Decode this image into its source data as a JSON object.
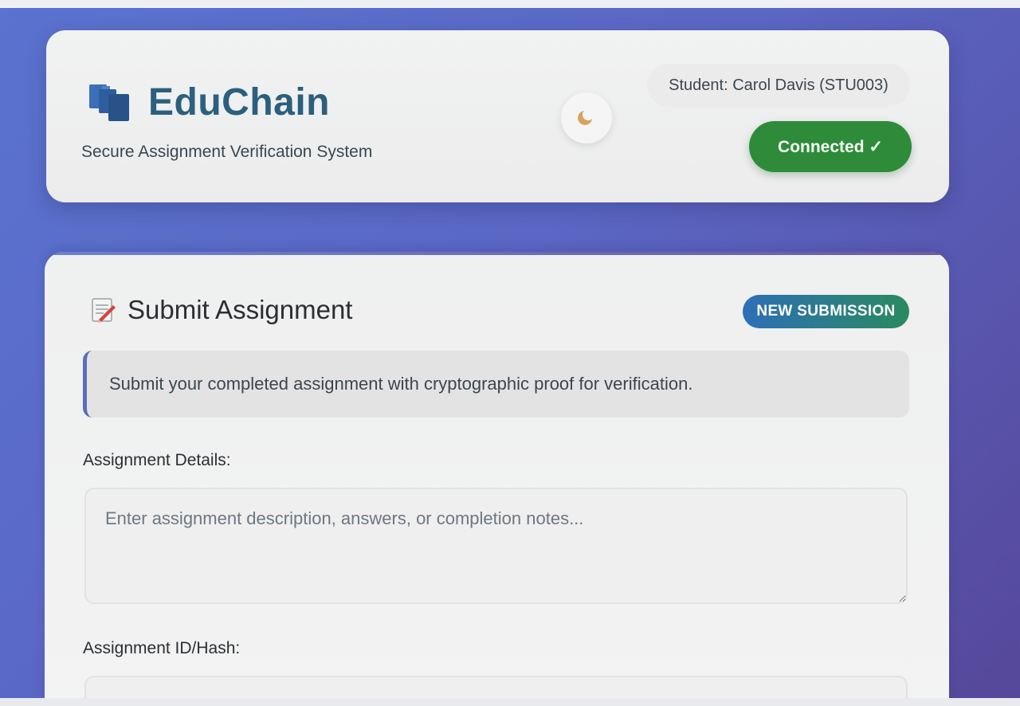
{
  "header": {
    "brand": {
      "title": "EduChain",
      "subtitle": "Secure Assignment Verification System",
      "icon": "document-stack-icon"
    },
    "theme_toggle_icon": "moon-icon",
    "student_label": "Student: Carol Davis (STU003)",
    "status_label": "Connected ✓",
    "status_color": "#2e8b3a"
  },
  "submit_section": {
    "icon": "memo-icon",
    "title": "Submit Assignment",
    "badge": "NEW SUBMISSION",
    "info_text": "Submit your completed assignment with cryptographic proof for verification.",
    "details_label": "Assignment Details:",
    "details_placeholder": "Enter assignment description, answers, or completion notes...",
    "details_value": "",
    "hash_label": "Assignment ID/Hash:",
    "hash_value": ""
  },
  "colors": {
    "background_start": "#5a73cf",
    "background_end": "#56479a",
    "brand_text": "#2c5f7e",
    "badge_gradient_start": "#2d6fb7",
    "badge_gradient_end": "#2a8a5e"
  }
}
